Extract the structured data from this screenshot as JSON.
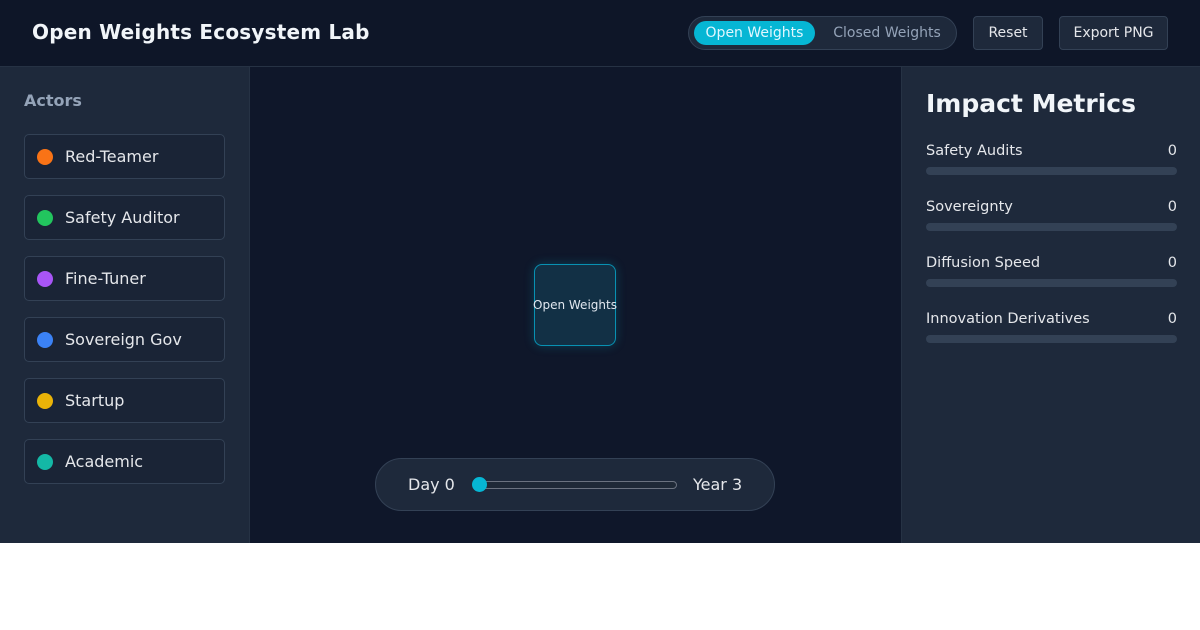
{
  "header": {
    "title": "Open Weights Ecosystem Lab",
    "mode_toggle": {
      "options": [
        "Open Weights",
        "Closed Weights"
      ],
      "selected": "Open Weights"
    },
    "reset_label": "Reset",
    "export_label": "Export PNG"
  },
  "sidebar": {
    "title": "Actors",
    "actors": [
      {
        "label": "Red-Teamer",
        "color": "#f97316"
      },
      {
        "label": "Safety Auditor",
        "color": "#22c55e"
      },
      {
        "label": "Fine-Tuner",
        "color": "#a855f7"
      },
      {
        "label": "Sovereign Gov",
        "color": "#3b82f6"
      },
      {
        "label": "Startup",
        "color": "#eab308"
      },
      {
        "label": "Academic",
        "color": "#14b8a6"
      }
    ]
  },
  "canvas": {
    "node_label": "Open Weights",
    "timeline": {
      "start_label": "Day 0",
      "end_label": "Year 3",
      "value": 0
    }
  },
  "metrics": {
    "title": "Impact Metrics",
    "items": [
      {
        "label": "Safety Audits",
        "value": "0",
        "fraction": 0
      },
      {
        "label": "Sovereignty",
        "value": "0",
        "fraction": 0
      },
      {
        "label": "Diffusion Speed",
        "value": "0",
        "fraction": 0
      },
      {
        "label": "Innovation Derivatives",
        "value": "0",
        "fraction": 0
      }
    ]
  },
  "colors": {
    "accent": "#06b6d4",
    "background": "#0f172a",
    "panel": "#1e293b"
  }
}
